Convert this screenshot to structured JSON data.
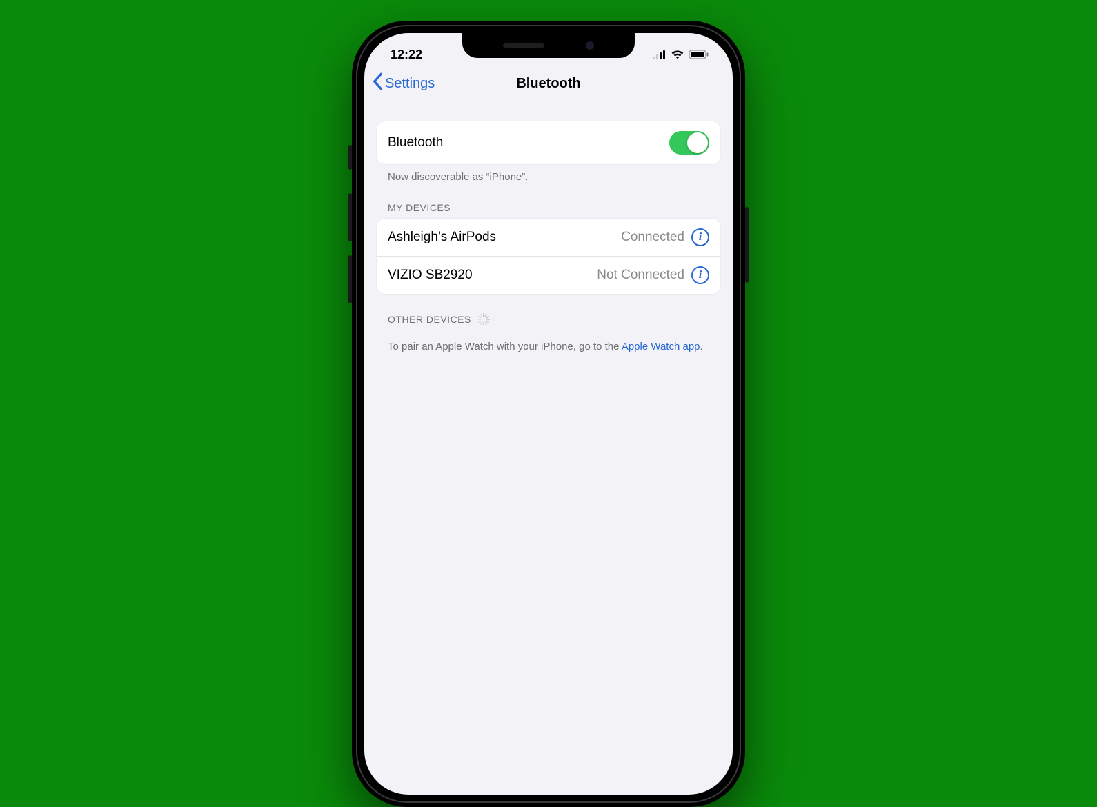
{
  "statusbar": {
    "time": "12:22"
  },
  "nav": {
    "back_label": "Settings",
    "title": "Bluetooth"
  },
  "bluetooth_row": {
    "label": "Bluetooth",
    "enabled": true
  },
  "discoverable_note": "Now discoverable as “iPhone”.",
  "sections": {
    "my_devices_header": "MY DEVICES",
    "other_devices_header": "OTHER DEVICES"
  },
  "my_devices": [
    {
      "name": "Ashleigh’s AirPods",
      "status": "Connected"
    },
    {
      "name": "VIZIO SB2920",
      "status": "Not Connected"
    }
  ],
  "pair_hint_prefix": "To pair an Apple Watch with your iPhone, go to the ",
  "pair_hint_link": "Apple Watch app",
  "pair_hint_suffix": ".",
  "colors": {
    "accent": "#2768d4",
    "toggle_on": "#34c759"
  }
}
